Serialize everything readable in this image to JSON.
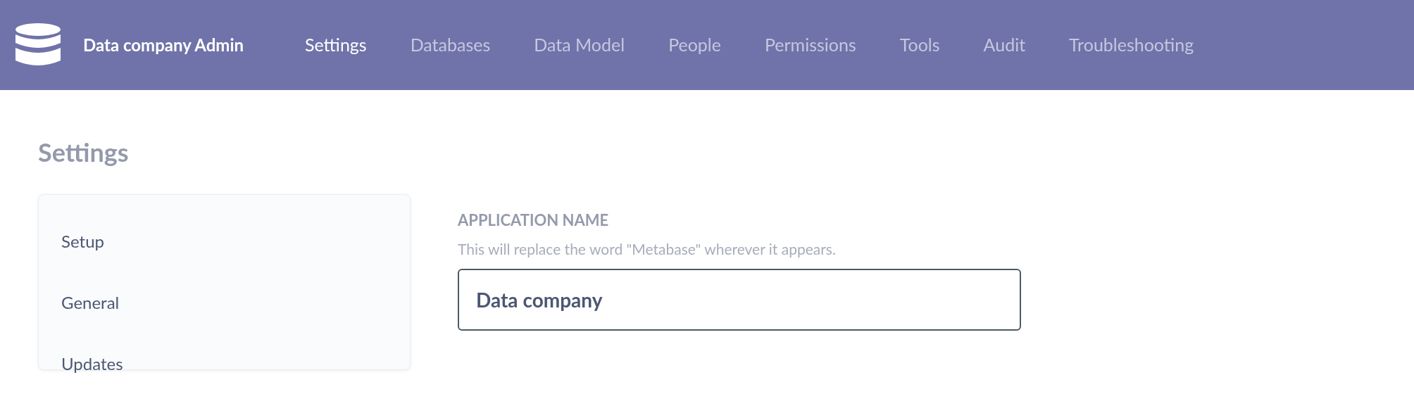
{
  "header": {
    "brand": "Data company Admin",
    "nav": [
      {
        "label": "Settings",
        "selected": true
      },
      {
        "label": "Databases",
        "selected": false
      },
      {
        "label": "Data Model",
        "selected": false
      },
      {
        "label": "People",
        "selected": false
      },
      {
        "label": "Permissions",
        "selected": false
      },
      {
        "label": "Tools",
        "selected": false
      },
      {
        "label": "Audit",
        "selected": false
      },
      {
        "label": "Troubleshooting",
        "selected": false
      }
    ]
  },
  "page_title": "Settings",
  "sidebar": {
    "items": [
      {
        "label": "Setup"
      },
      {
        "label": "General"
      },
      {
        "label": "Updates"
      }
    ]
  },
  "setting": {
    "label": "APPLICATION NAME",
    "description": "This will replace the word \"Metabase\" wherever it appears.",
    "value": "Data company"
  }
}
